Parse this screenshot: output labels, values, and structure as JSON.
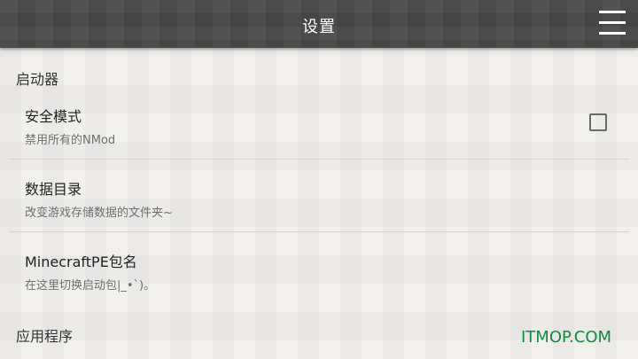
{
  "header": {
    "title": "设置"
  },
  "sections": [
    {
      "label": "启动器"
    },
    {
      "label": "应用程序"
    }
  ],
  "items": [
    {
      "title": "安全模式",
      "subtitle": "禁用所有的NMod",
      "checked": false
    },
    {
      "title": "数据目录",
      "subtitle": "改变游戏存储数据的文件夹~"
    },
    {
      "title": "MinecraftPE包名",
      "subtitle": "在这里切换启动包|_•`)。"
    }
  ],
  "icons": {
    "menu": "hamburger-menu-icon"
  },
  "watermark": "ITMOP.COM",
  "colors": {
    "topbar": "#4b4b4b",
    "watermark": "#0f8a3e"
  }
}
